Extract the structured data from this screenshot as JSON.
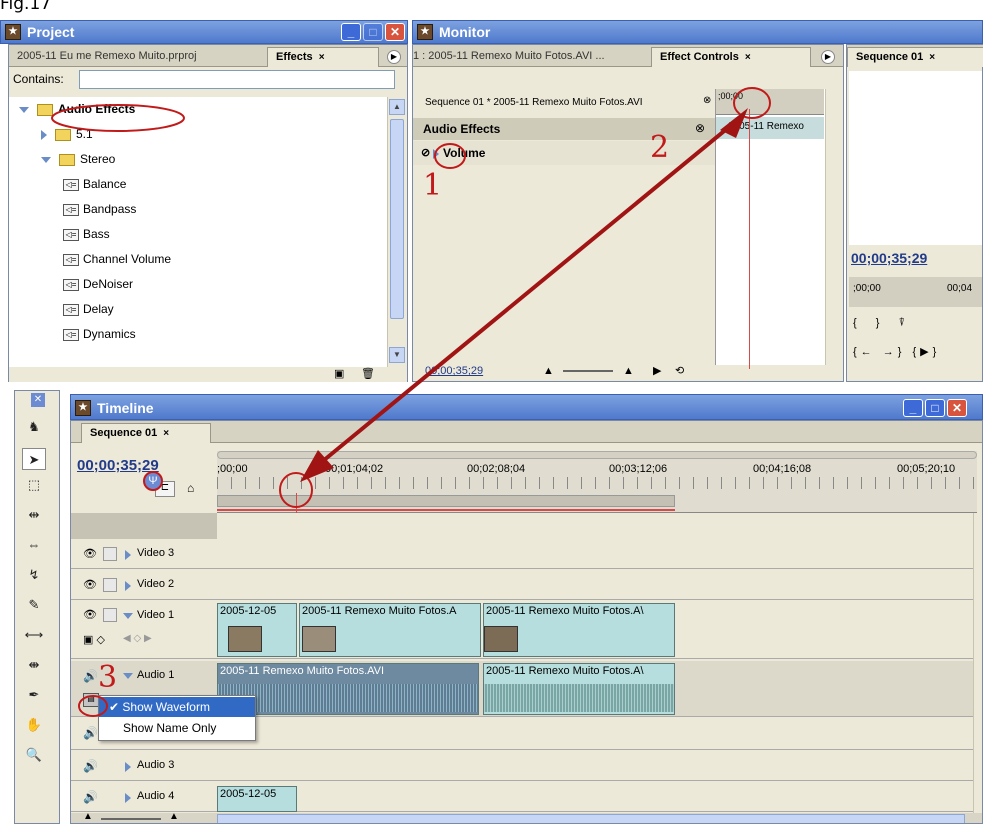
{
  "figure_label": "Fig.17",
  "project": {
    "title": "Project",
    "tabs": [
      "2005-11 Eu me Remexo Muito.prproj",
      "Effects"
    ],
    "tab_close": "×",
    "contains_label": "Contains:",
    "contains_value": "",
    "tree": [
      {
        "label": "Audio Effects",
        "indent": 0,
        "type": "folder",
        "expanded": true
      },
      {
        "label": "5.1",
        "indent": 1,
        "type": "folder",
        "expanded": false
      },
      {
        "label": "Stereo",
        "indent": 1,
        "type": "folder",
        "expanded": true
      },
      {
        "label": "Balance",
        "indent": 2,
        "type": "effect"
      },
      {
        "label": "Bandpass",
        "indent": 2,
        "type": "effect"
      },
      {
        "label": "Bass",
        "indent": 2,
        "type": "effect"
      },
      {
        "label": "Channel Volume",
        "indent": 2,
        "type": "effect"
      },
      {
        "label": "DeNoiser",
        "indent": 2,
        "type": "effect"
      },
      {
        "label": "Delay",
        "indent": 2,
        "type": "effect"
      },
      {
        "label": "Dynamics",
        "indent": 2,
        "type": "effect"
      }
    ]
  },
  "monitor": {
    "title": "Monitor",
    "tabs": [
      "1 : 2005-11 Remexo Muito Fotos.AVI ...",
      "Effect Controls"
    ],
    "seq_tab": "Sequence 01",
    "header_text": "Sequence 01 * 2005-11 Remexo Muito Fotos.AVI",
    "mini_time": ";00;00",
    "section": "Audio Effects",
    "effect": "Volume",
    "clip_label": "2005-11 Remexo",
    "timecode": "00;00;35;29",
    "program_timecode": "00;00;35;29",
    "program_ruler": [
      ";00;00",
      "00;04"
    ]
  },
  "timeline": {
    "title": "Timeline",
    "seq_tab": "Sequence 01",
    "timecode": "00;00;35;29",
    "ruler": ";00;00",
    "ruler_marks": [
      "00;01;04;02",
      "00;02;08;04",
      "00;03;12;06",
      "00;04;16;08",
      "00;05;20;10"
    ],
    "tracks": [
      "Video 3",
      "Video 2",
      "Video 1",
      "Audio 1",
      "Audio 2",
      "Audio 3",
      "Audio 4"
    ],
    "video_clips": [
      "2005-12-05",
      "2005-11 Remexo Muito Fotos.A",
      "2005-11 Remexo Muito Fotos.A\\"
    ],
    "audio_clips": [
      "2005-11 Remexo Muito Fotos.AVI",
      "2005-11 Remexo Muito Fotos.A\\"
    ],
    "audio4_clip": "2005-12-05",
    "context_menu": [
      "Show Waveform",
      "Show Name Only"
    ],
    "checked_item": "Show Waveform"
  },
  "annotations": [
    "1",
    "2",
    "3"
  ],
  "colors": {
    "annotation": "#c21a1a",
    "titlebar": "#5b84d4",
    "panel": "#ece9d8",
    "clip": "#b7dede"
  }
}
